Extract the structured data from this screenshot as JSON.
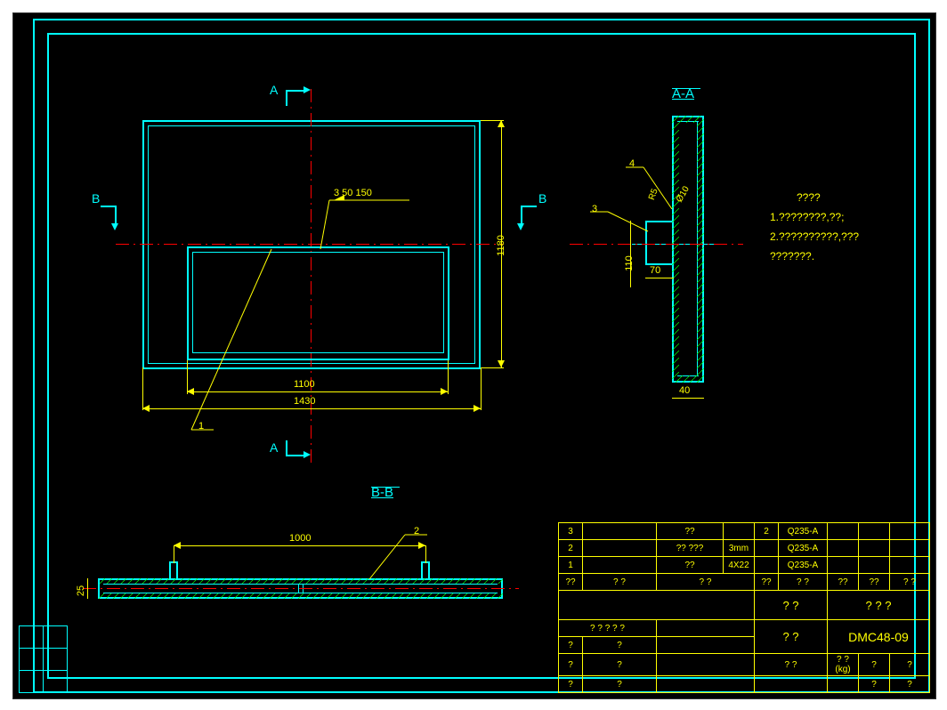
{
  "drawing_number": "DMC48-09",
  "sections": {
    "a": "A",
    "aa": "A-A",
    "b": "B",
    "bb": "B-B"
  },
  "main_view": {
    "dim_width_outer": "1430",
    "dim_width_inner": "1100",
    "dim_height": "1180",
    "weld_note": "3  50  150",
    "ref_1": "1"
  },
  "section_aa": {
    "dim_40": "40",
    "dim_70": "70",
    "dim_110": "110",
    "dim_phi10": "Ø10",
    "dim_r5": "R5",
    "ref_4": "4",
    "ref_3": "3"
  },
  "section_bb": {
    "dim_25": "25",
    "dim_1000": "1000",
    "ref_2": "2"
  },
  "notes": {
    "title": "????",
    "line1": "1.????????,??;",
    "line2": "2.??????????,???",
    "line3": "   ???????."
  },
  "bom": [
    {
      "no": "3",
      "name": "??",
      "spec": "",
      "qty": "2",
      "mat": "Q235-A",
      "wt": "",
      "note": ""
    },
    {
      "no": "2",
      "name": "?? ???",
      "spec": "3mm",
      "qty": "",
      "mat": "Q235-A",
      "wt": "",
      "note": ""
    },
    {
      "no": "1",
      "name": "??",
      "spec": "4X22",
      "qty": "",
      "mat": "Q235-A",
      "wt": "",
      "note": ""
    }
  ],
  "bom_hdr": {
    "c1": "??",
    "c2": "?   ?",
    "c3": "?      ?",
    "c4": "??",
    "c5": "?  ?",
    "c6": "??",
    "c7": "??",
    "c8": "?  ?"
  },
  "title_block": {
    "r1c1": "",
    "r1c2": "?    ?",
    "r1c3": "?  ?  ?",
    "r2c1a": "? ? ? ? ?",
    "r2c1b": "",
    "r2c2": "?    ?",
    "r2c3": "DMC48-09",
    "r3c1a": "?",
    "r3c1b": "?",
    "r3c1c": "",
    "r3c2": "",
    "r3c3": "",
    "r3c4": "",
    "r4c1a": "?",
    "r4c1b": "?",
    "r4c1c": "",
    "r4c2": "?  ?",
    "r4c3": "? ? (kg)",
    "r4c4a": "?",
    "r4c4b": "?",
    "r5c1a": "?",
    "r5c1b": "?",
    "r5c1c": "",
    "r5c2": "",
    "r5c3": "",
    "r5c4a": "?",
    "r5c4b": "?"
  }
}
